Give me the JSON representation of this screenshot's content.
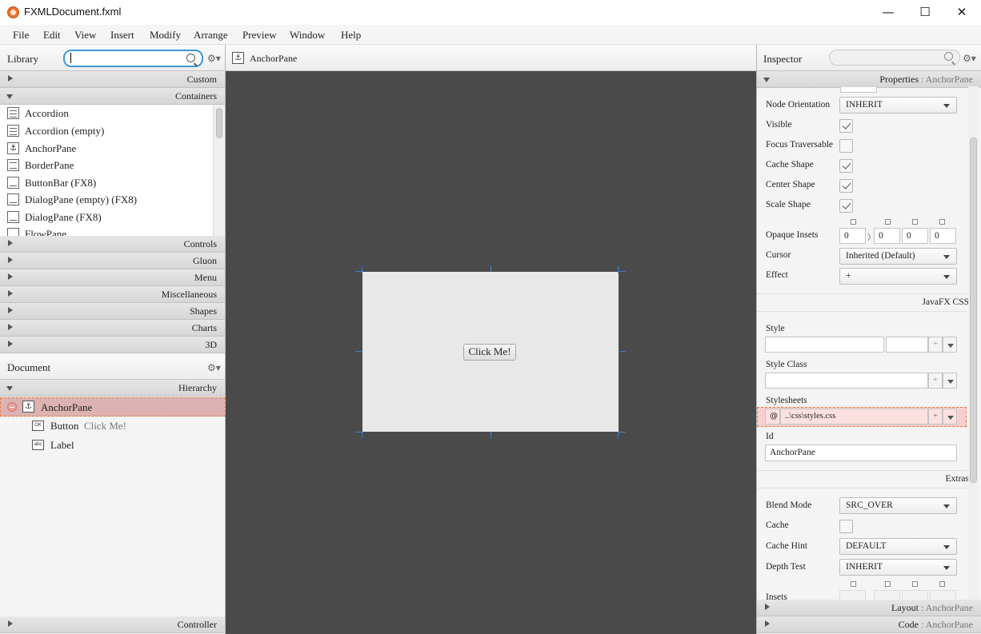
{
  "window": {
    "title": "FXMLDocument.fxml",
    "minimize": "—",
    "maximize": "☐",
    "close": "✕"
  },
  "menu": [
    "File",
    "Edit",
    "View",
    "Insert",
    "Modify",
    "Arrange",
    "Preview",
    "Window",
    "Help"
  ],
  "library": {
    "title": "Library",
    "search_value": "",
    "sections_top": [
      "Custom",
      "Containers"
    ],
    "container_items": [
      "Accordion",
      "Accordion  (empty)",
      "AnchorPane",
      "BorderPane",
      "ButtonBar  (FX8)",
      "DialogPane (empty)   (FX8)",
      "DialogPane  (FX8)",
      "FlowPane"
    ],
    "sections_bottom": [
      "Controls",
      "Gluon",
      "Menu",
      "Miscellaneous",
      "Shapes",
      "Charts",
      "3D"
    ]
  },
  "document": {
    "title": "Document",
    "hierarchy_label": "Hierarchy",
    "tree": [
      {
        "type": "AnchorPane",
        "text": ""
      },
      {
        "type": "Button",
        "text": "Click Me!"
      },
      {
        "type": "Label",
        "text": ""
      }
    ],
    "controller_label": "Controller"
  },
  "center": {
    "breadcrumb": "AnchorPane",
    "button_text": "Click Me!"
  },
  "inspector": {
    "title": "Inspector",
    "properties_label": "Properties",
    "properties_target": "AnchorPane",
    "node_orientation": {
      "label": "Node Orientation",
      "value": "INHERIT"
    },
    "visible": {
      "label": "Visible",
      "checked": true
    },
    "focus_traversable": {
      "label": "Focus Traversable",
      "checked": false
    },
    "cache_shape": {
      "label": "Cache Shape",
      "checked": true
    },
    "center_shape": {
      "label": "Center Shape",
      "checked": true
    },
    "scale_shape": {
      "label": "Scale Shape",
      "checked": true
    },
    "opaque_insets": {
      "label": "Opaque Insets",
      "values": [
        "0",
        "0",
        "0",
        "0"
      ],
      "link": "〉"
    },
    "cursor": {
      "label": "Cursor",
      "value": "Inherited (Default)"
    },
    "effect": {
      "label": "Effect",
      "value": "+"
    },
    "javafx_css_label": "JavaFX CSS",
    "style": {
      "label": "Style"
    },
    "style_class": {
      "label": "Style Class"
    },
    "stylesheets": {
      "label": "Stylesheets",
      "prefix": "@",
      "value": "..\\css\\styles.css"
    },
    "id": {
      "label": "Id",
      "value": "AnchorPane"
    },
    "extras_label": "Extras",
    "blend_mode": {
      "label": "Blend Mode",
      "value": "SRC_OVER"
    },
    "cache": {
      "label": "Cache",
      "checked": false
    },
    "cache_hint": {
      "label": "Cache Hint",
      "value": "DEFAULT"
    },
    "depth_test": {
      "label": "Depth Test",
      "value": "INHERIT"
    },
    "insets": {
      "label": "Insets"
    },
    "plus": "+",
    "layout_label": "Layout",
    "layout_target": "AnchorPane",
    "code_label": "Code",
    "code_target": "AnchorPane",
    "separator": " : "
  }
}
